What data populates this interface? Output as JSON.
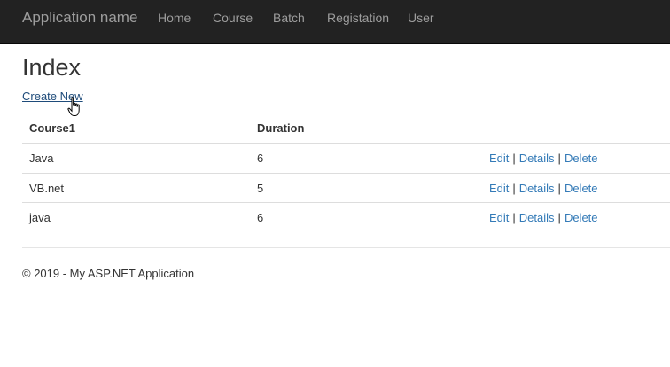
{
  "navbar": {
    "brand": "Application name",
    "items": [
      {
        "label": "Home"
      },
      {
        "label": "Course"
      },
      {
        "label": "Batch"
      },
      {
        "label": "Registation"
      },
      {
        "label": "User"
      }
    ]
  },
  "main": {
    "title": "Index",
    "create_link": "Create New",
    "table": {
      "headers": [
        "Course1",
        "Duration"
      ],
      "rows": [
        {
          "course": "Java",
          "duration": "6"
        },
        {
          "course": "VB.net",
          "duration": "5"
        },
        {
          "course": "java",
          "duration": "6"
        }
      ],
      "actions": {
        "edit": "Edit",
        "details": "Details",
        "delete": "Delete",
        "separator": "|"
      }
    }
  },
  "footer": {
    "text": "© 2019 - My ASP.NET Application"
  },
  "colors": {
    "navbar_bg": "#222222",
    "nav_text": "#9d9d9d",
    "link": "#337ab7",
    "border": "#dddddd"
  },
  "icons": {
    "cursor": "hand-pointer-icon"
  }
}
